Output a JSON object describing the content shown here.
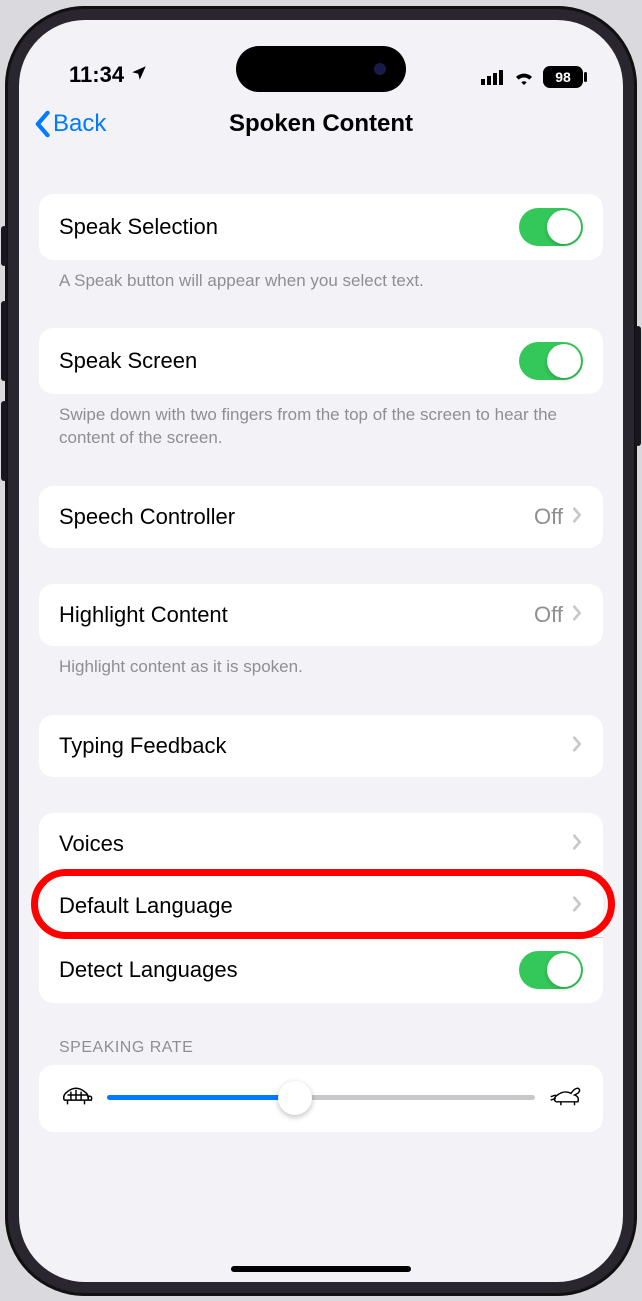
{
  "status": {
    "time": "11:34",
    "battery": "98"
  },
  "nav": {
    "back": "Back",
    "title": "Spoken Content"
  },
  "rows": {
    "speakSelection": {
      "label": "Speak Selection",
      "on": true,
      "footer": "A Speak button will appear when you select text."
    },
    "speakScreen": {
      "label": "Speak Screen",
      "on": true,
      "footer": "Swipe down with two fingers from the top of the screen to hear the content of the screen."
    },
    "speechController": {
      "label": "Speech Controller",
      "value": "Off"
    },
    "highlightContent": {
      "label": "Highlight Content",
      "value": "Off",
      "footer": "Highlight content as it is spoken."
    },
    "typingFeedback": {
      "label": "Typing Feedback"
    },
    "voices": {
      "label": "Voices"
    },
    "defaultLanguage": {
      "label": "Default Language"
    },
    "detectLanguages": {
      "label": "Detect Languages",
      "on": true
    }
  },
  "speakingRate": {
    "header": "SPEAKING RATE",
    "value": 44
  }
}
